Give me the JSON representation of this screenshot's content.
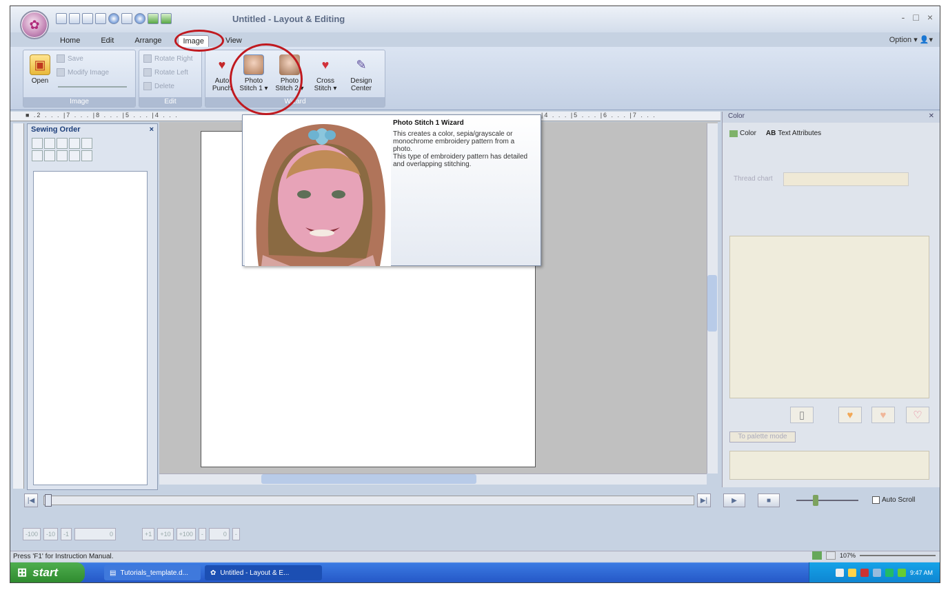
{
  "window": {
    "title": "Untitled - Layout & Editing",
    "controls": [
      "-",
      "□",
      "×"
    ]
  },
  "tabs": [
    "Home",
    "Edit",
    "Arrange",
    "Image",
    "View"
  ],
  "option_label": "Option",
  "ribbon": {
    "image_group": {
      "label": "Image",
      "open": "Open",
      "save": "Save",
      "modify": "Modify Image"
    },
    "edit_group": {
      "label": "Edit",
      "rotate_right": "Rotate Right",
      "rotate_left": "Rotate Left",
      "delete": "Delete"
    },
    "wizard_group": {
      "label": "Wizard",
      "buttons": [
        {
          "name": "Auto",
          "sub": "Punch"
        },
        {
          "name": "Photo",
          "sub": "Stitch 1 ▾"
        },
        {
          "name": "Photo",
          "sub": "Stitch 2 ▾"
        },
        {
          "name": "Cross",
          "sub": "Stitch ▾"
        },
        {
          "name": "Design",
          "sub": "Center"
        }
      ]
    }
  },
  "ruler_text": "■ .2 . . . |7 . . . |8 . . . |5 . . . |4 . . .",
  "ruler_right": "|4 . . . |5 . . . |6 . . . |7 . . .",
  "sewing_order": {
    "title": "Sewing Order"
  },
  "tooltip": {
    "title": "Photo Stitch 1 Wizard",
    "desc": "This creates a color, sepia/grayscale or monochrome embroidery pattern from a photo.\nThis type of embroidery pattern has detailed and overlapping stitching."
  },
  "color_panel": {
    "title": "Color",
    "tabs": [
      "Color",
      "Text Attributes"
    ],
    "thread_label": "Thread chart",
    "palette_mode": "To palette mode"
  },
  "playback": {
    "auto_scroll": "Auto Scroll"
  },
  "bottom_toolbar": [
    "-100",
    "-10",
    "-1",
    "0",
    "+1",
    "+10",
    "+100",
    "-",
    "0",
    "-"
  ],
  "status": {
    "text": "Press 'F1' for Instruction Manual.",
    "zoom": "107%"
  },
  "taskbar": {
    "start": "start",
    "items": [
      "Tutorials_template.d...",
      "Untitled - Layout & E..."
    ],
    "time": "9:47 AM"
  },
  "colors": {
    "accent": "#c0191f",
    "taskbar": "#2456c6",
    "ribbon": "#c3d0e4"
  }
}
